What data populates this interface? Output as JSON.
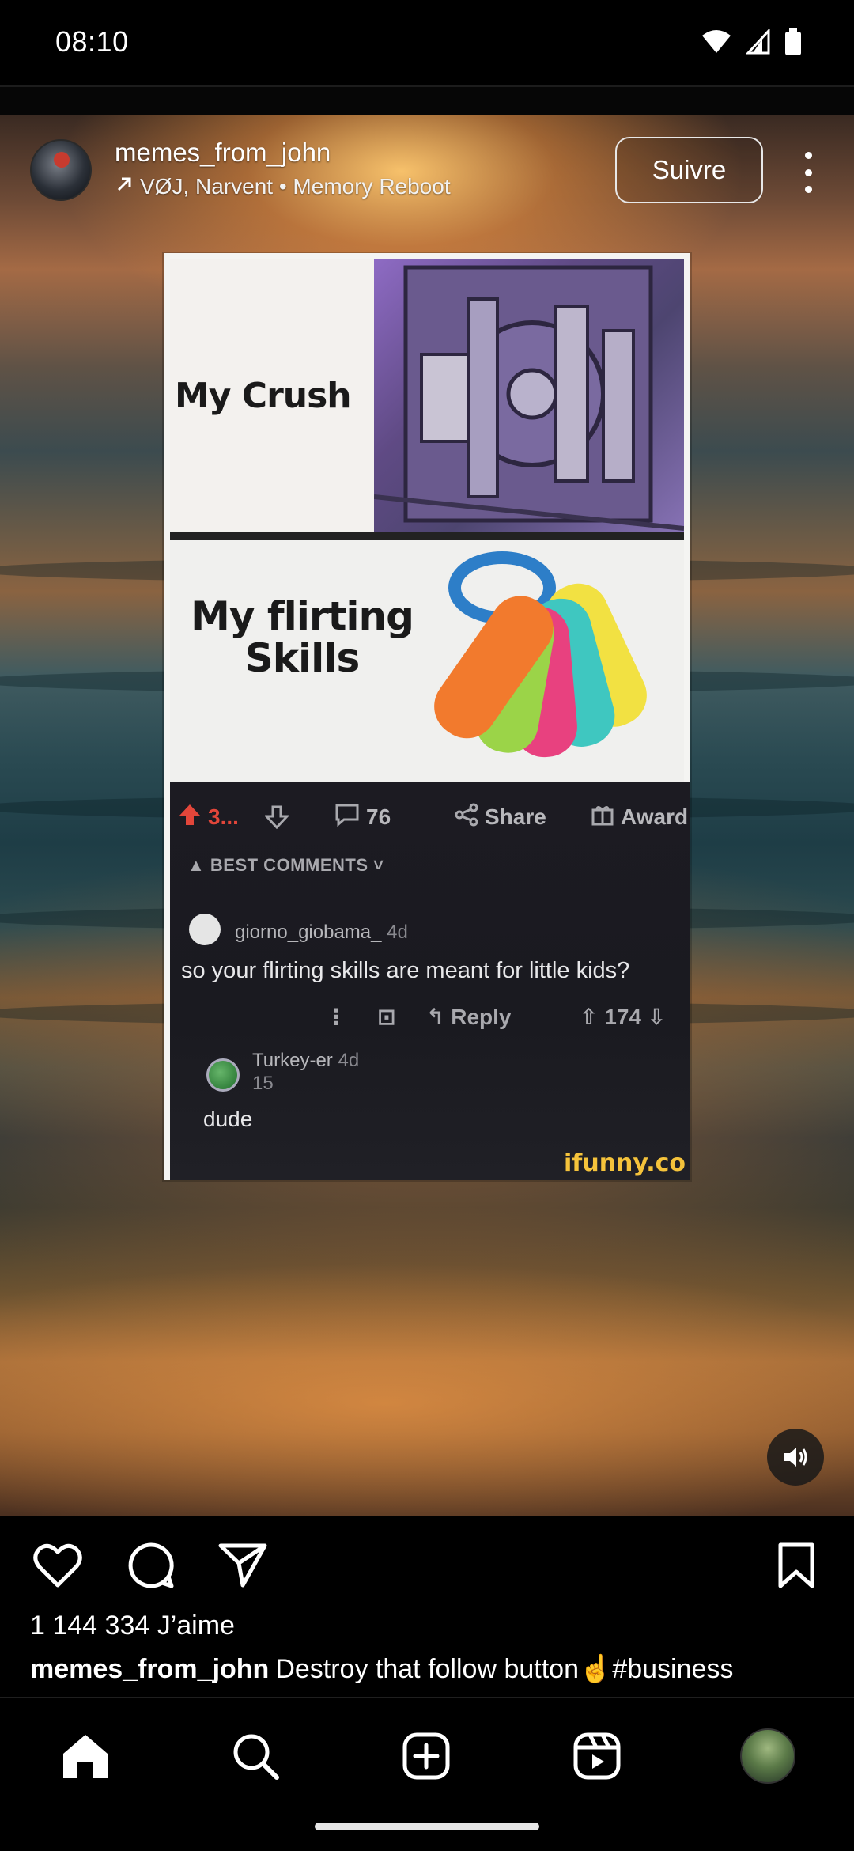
{
  "status_bar": {
    "time": "08:10",
    "icons": [
      "wifi-icon",
      "cell-signal-icon",
      "battery-icon"
    ]
  },
  "post": {
    "username": "memes_from_john",
    "audio": "VØJ, Narvent • Memory Reboot",
    "follow_label": "Suivre",
    "more_icon": "more-vertical-icon"
  },
  "meme": {
    "crush_label": "My Crush",
    "flirting_label_line1": "My flirting",
    "flirting_label_line2": "Skills",
    "upvotes": "3...",
    "comments": "76",
    "share": "Share",
    "award": "Award",
    "best_comments": "BEST COMMENTS",
    "comment_user": "giorno_giobama_",
    "comment_age": "4d",
    "comment_text": "so your flirting skills are meant for little kids?",
    "reply_label": "Reply",
    "comment_votes": "174",
    "reply_user": "Turkey-er",
    "reply_age": "4d",
    "reply_votes": "15",
    "reply_text": "dude",
    "watermark": "ifunny.co"
  },
  "actions": {
    "like_icon": "heart-icon",
    "comment_icon": "comment-icon",
    "share_icon": "send-icon",
    "save_icon": "bookmark-icon",
    "sound_icon": "volume-on-icon"
  },
  "likes_text": "1 144 334 J’aime",
  "caption": {
    "username": "memes_from_john",
    "text": "Destroy that follow button☝️#business"
  },
  "bottom_nav": [
    "home-icon",
    "search-icon",
    "create-icon",
    "reels-icon",
    "profile-avatar"
  ]
}
